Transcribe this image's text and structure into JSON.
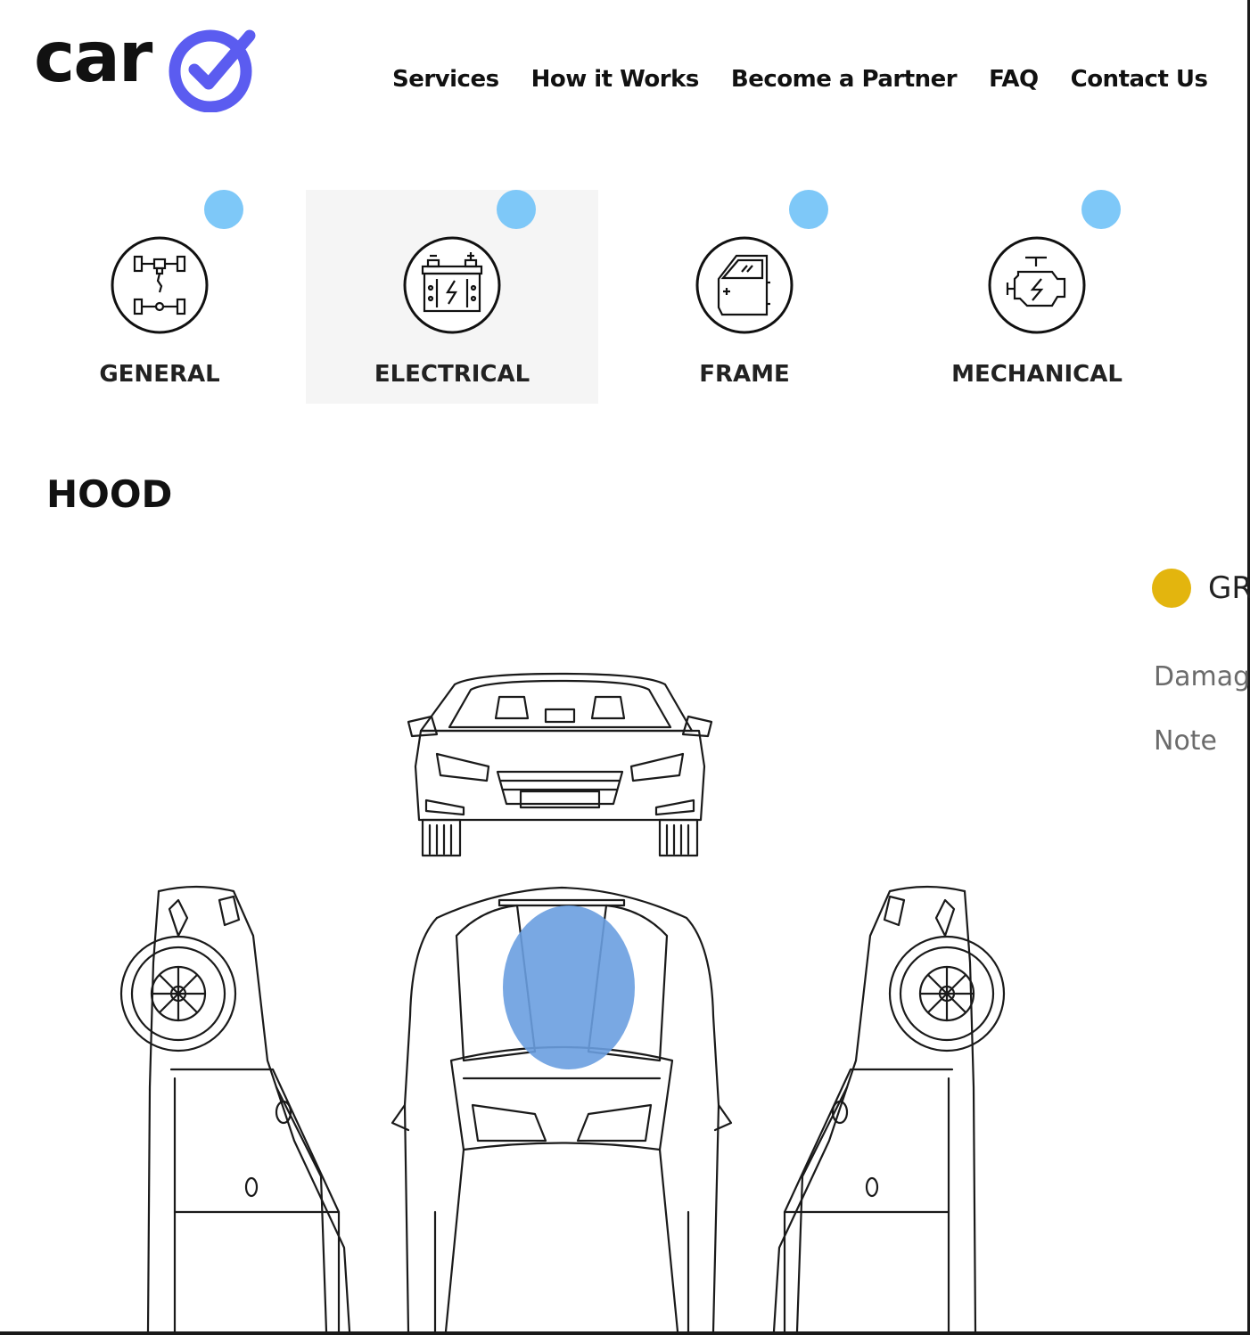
{
  "brand": {
    "logo_text": "car",
    "accent_color": "#5b5cf0",
    "check_icon": "check-circle-icon"
  },
  "nav": {
    "items": [
      {
        "label": "Services"
      },
      {
        "label": "How it Works"
      },
      {
        "label": "Become a Partner"
      },
      {
        "label": "FAQ"
      },
      {
        "label": "Contact Us"
      }
    ]
  },
  "categories": {
    "active": "ELECTRICAL",
    "indicator_color": "#7ec8f8",
    "items": [
      {
        "label": "GENERAL",
        "icon": "axle-drivetrain-icon"
      },
      {
        "label": "ELECTRICAL",
        "icon": "battery-icon"
      },
      {
        "label": "FRAME",
        "icon": "car-door-icon"
      },
      {
        "label": "MECHANICAL",
        "icon": "engine-icon"
      }
    ]
  },
  "section": {
    "title": "HOOD"
  },
  "damage_panel": {
    "grade_color": "#e3b50e",
    "grade_label": "GR",
    "fields": [
      {
        "label": "Damag"
      },
      {
        "label": "Note"
      }
    ]
  },
  "diagram": {
    "selected_part": "hood",
    "highlight_color": "#6a9fe0",
    "views": [
      "front",
      "left-side",
      "top",
      "right-side"
    ]
  }
}
